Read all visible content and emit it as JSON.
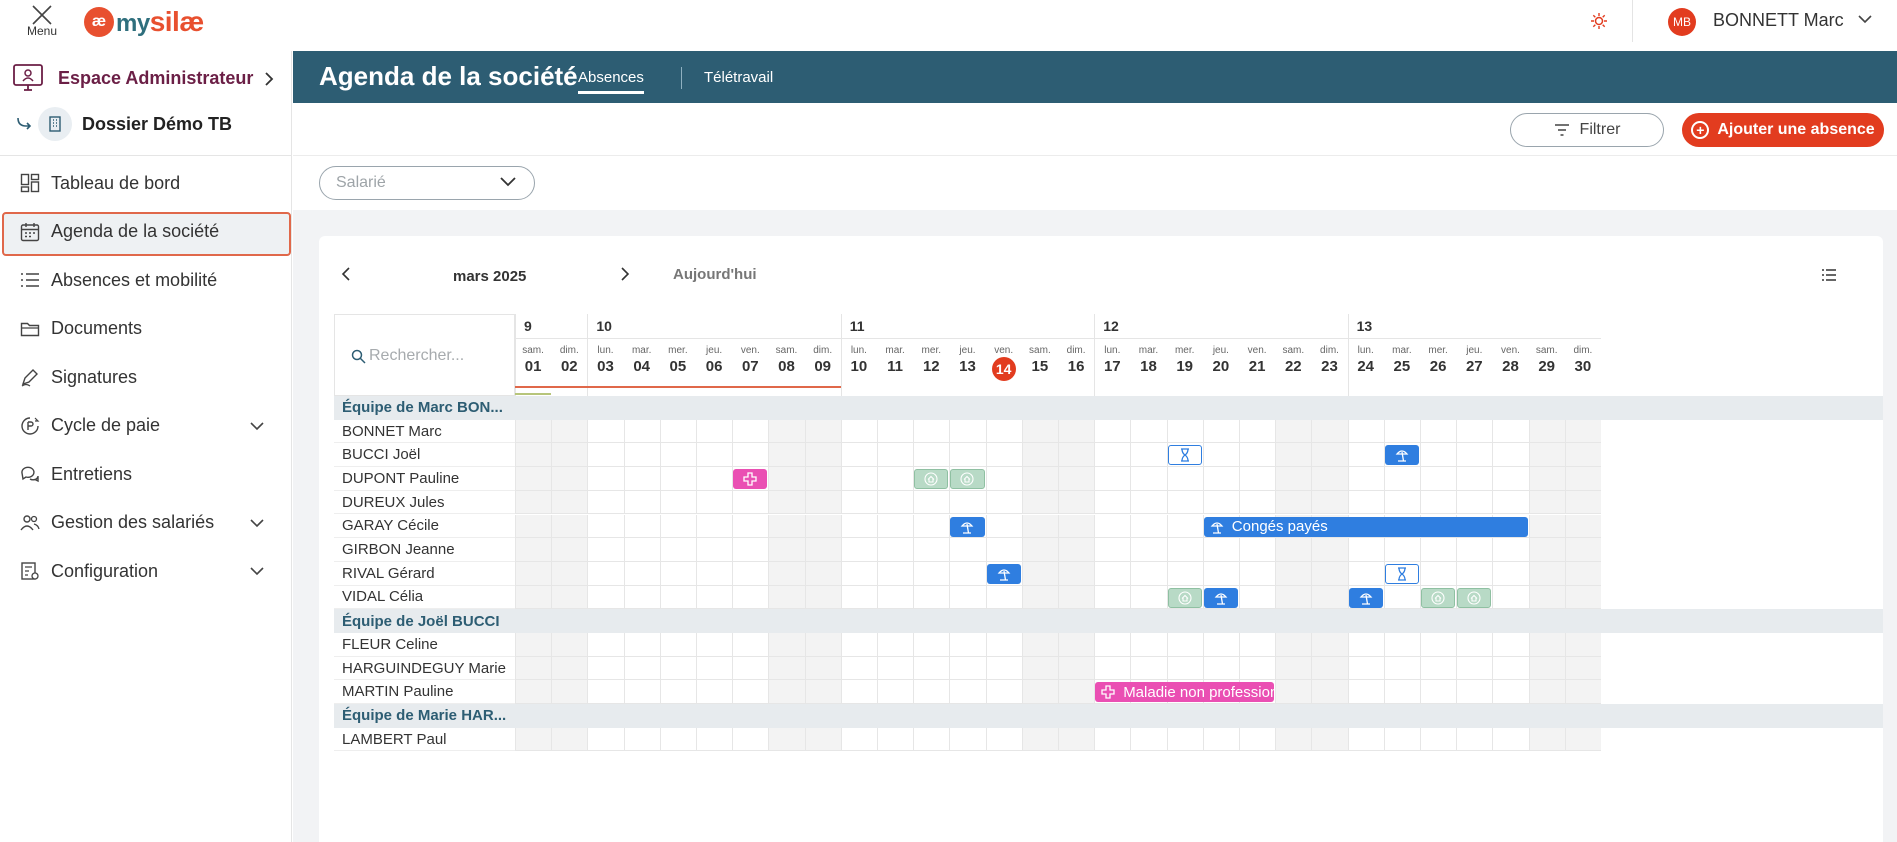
{
  "topbar": {
    "menu_label": "Menu",
    "logo_mark": "æ",
    "logo_my": "my",
    "logo_name": "silæ",
    "user_initials": "MB",
    "user_name": "BONNETT Marc"
  },
  "sidebar": {
    "admin_label": "Espace Administrateur",
    "dossier_label": "Dossier Démo TB",
    "items": [
      {
        "label": "Tableau de bord",
        "icon": "dashboard-icon",
        "active": false,
        "expandable": false
      },
      {
        "label": "Agenda de la société",
        "icon": "calendar-icon",
        "active": true,
        "expandable": false
      },
      {
        "label": "Absences et mobilité",
        "icon": "list-icon",
        "active": false,
        "expandable": false
      },
      {
        "label": "Documents",
        "icon": "folder-icon",
        "active": false,
        "expandable": false
      },
      {
        "label": "Signatures",
        "icon": "pen-icon",
        "active": false,
        "expandable": false
      },
      {
        "label": "Cycle de paie",
        "icon": "payroll-icon",
        "active": false,
        "expandable": true
      },
      {
        "label": "Entretiens",
        "icon": "chat-icon",
        "active": false,
        "expandable": false
      },
      {
        "label": "Gestion des salariés",
        "icon": "users-icon",
        "active": false,
        "expandable": true
      },
      {
        "label": "Configuration",
        "icon": "config-icon",
        "active": false,
        "expandable": true
      }
    ]
  },
  "header": {
    "title": "Agenda de la société",
    "tabs": [
      {
        "label": "Absences",
        "active": true
      },
      {
        "label": "Télétravail",
        "active": false
      }
    ]
  },
  "toolbar": {
    "filter_label": "Filtrer",
    "add_label": "Ajouter une absence"
  },
  "filters": {
    "salarie_placeholder": "Salarié"
  },
  "calendar": {
    "month_label": "mars 2025",
    "today_label": "Aujourd'hui",
    "search_placeholder": "Rechercher...",
    "weeks": [
      {
        "label": "9",
        "start": 0
      },
      {
        "label": "10",
        "start": 2
      },
      {
        "label": "11",
        "start": 9
      },
      {
        "label": "12",
        "start": 16
      },
      {
        "label": "13",
        "start": 23
      }
    ],
    "days": [
      {
        "n": "sam.",
        "d": "01"
      },
      {
        "n": "dim.",
        "d": "02"
      },
      {
        "n": "lun.",
        "d": "03"
      },
      {
        "n": "mar.",
        "d": "04"
      },
      {
        "n": "mer.",
        "d": "05"
      },
      {
        "n": "jeu.",
        "d": "06"
      },
      {
        "n": "ven.",
        "d": "07"
      },
      {
        "n": "sam.",
        "d": "08"
      },
      {
        "n": "dim.",
        "d": "09"
      },
      {
        "n": "lun.",
        "d": "10"
      },
      {
        "n": "mar.",
        "d": "11"
      },
      {
        "n": "mer.",
        "d": "12"
      },
      {
        "n": "jeu.",
        "d": "13"
      },
      {
        "n": "ven.",
        "d": "14"
      },
      {
        "n": "sam.",
        "d": "15"
      },
      {
        "n": "dim.",
        "d": "16"
      },
      {
        "n": "lun.",
        "d": "17"
      },
      {
        "n": "mar.",
        "d": "18"
      },
      {
        "n": "mer.",
        "d": "19"
      },
      {
        "n": "jeu.",
        "d": "20"
      },
      {
        "n": "ven.",
        "d": "21"
      },
      {
        "n": "sam.",
        "d": "22"
      },
      {
        "n": "dim.",
        "d": "23"
      },
      {
        "n": "lun.",
        "d": "24"
      },
      {
        "n": "mar.",
        "d": "25"
      },
      {
        "n": "mer.",
        "d": "26"
      },
      {
        "n": "jeu.",
        "d": "27"
      },
      {
        "n": "ven.",
        "d": "28"
      },
      {
        "n": "sam.",
        "d": "29"
      },
      {
        "n": "dim.",
        "d": "30"
      }
    ],
    "today_index": 13,
    "rows": [
      {
        "type": "team",
        "label": "Équipe de Marc BON..."
      },
      {
        "type": "person",
        "label": "BONNET Marc",
        "events": []
      },
      {
        "type": "person",
        "label": "BUCCI Joël",
        "events": [
          {
            "start": 18,
            "span": 1,
            "kind": "outline",
            "icon": "hourglass-icon"
          },
          {
            "start": 24,
            "span": 1,
            "kind": "blue",
            "icon": "beach-icon"
          }
        ]
      },
      {
        "type": "person",
        "label": "DUPONT Pauline",
        "events": [
          {
            "start": 6,
            "span": 1,
            "kind": "pink",
            "icon": "cross-icon"
          },
          {
            "start": 11,
            "span": 1,
            "kind": "green",
            "icon": "home-icon"
          },
          {
            "start": 12,
            "span": 1,
            "kind": "green",
            "icon": "home-icon"
          }
        ]
      },
      {
        "type": "person",
        "label": "DUREUX Jules",
        "events": []
      },
      {
        "type": "person",
        "label": "GARAY Cécile",
        "events": [
          {
            "start": 12,
            "span": 1,
            "kind": "blue",
            "icon": "beach-icon"
          },
          {
            "start": 19,
            "span": 9,
            "kind": "blue",
            "icon": "beach-icon",
            "label": "Congés payés"
          }
        ]
      },
      {
        "type": "person",
        "label": "GIRBON Jeanne",
        "events": []
      },
      {
        "type": "person",
        "label": "RIVAL Gérard",
        "events": [
          {
            "start": 13,
            "span": 1,
            "kind": "blue",
            "icon": "beach-icon"
          },
          {
            "start": 24,
            "span": 1,
            "kind": "outline",
            "icon": "hourglass-icon"
          }
        ]
      },
      {
        "type": "person",
        "label": "VIDAL Célia",
        "events": [
          {
            "start": 18,
            "span": 1,
            "kind": "green",
            "icon": "home-icon"
          },
          {
            "start": 19,
            "span": 1,
            "kind": "blue",
            "icon": "beach-icon"
          },
          {
            "start": 23,
            "span": 1,
            "kind": "blue",
            "icon": "beach-icon"
          },
          {
            "start": 25,
            "span": 1,
            "kind": "green",
            "icon": "home-icon"
          },
          {
            "start": 26,
            "span": 1,
            "kind": "green",
            "icon": "home-icon"
          }
        ]
      },
      {
        "type": "team",
        "label": "Équipe de Joël BUCCI"
      },
      {
        "type": "person",
        "label": "FLEUR Celine",
        "events": []
      },
      {
        "type": "person",
        "label": "HARGUINDEGUY Marie",
        "events": []
      },
      {
        "type": "person",
        "label": "MARTIN Pauline",
        "events": [
          {
            "start": 16,
            "span": 5,
            "kind": "pink",
            "icon": "cross-icon",
            "label": "Maladie non professionnelle"
          }
        ]
      },
      {
        "type": "team",
        "label": "Équipe de Marie HAR..."
      },
      {
        "type": "person",
        "label": "LAMBERT Paul",
        "events": []
      }
    ]
  },
  "colors": {
    "brand_red": "#e23c1f",
    "header_band": "#2d5d73",
    "event_blue": "#2f7ee0",
    "event_pink": "#ea4fb3",
    "event_green": "#b8dac6"
  }
}
